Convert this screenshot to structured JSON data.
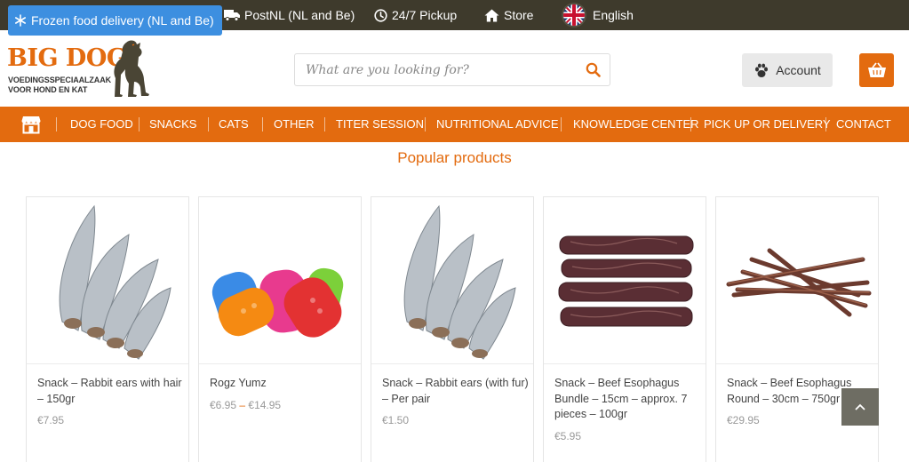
{
  "topbar": {
    "items": [
      {
        "label": "Frozen food delivery (NL and Be)",
        "icon": "snowflake-icon"
      },
      {
        "label": "PostNL (NL and Be)",
        "icon": "truck-icon"
      },
      {
        "label": "24/7 Pickup",
        "icon": "clock-icon"
      },
      {
        "label": "Store",
        "icon": "home-icon"
      }
    ],
    "language": "English",
    "language_icon": "uk-flag-icon"
  },
  "header": {
    "logo_title": "BIG DOG",
    "logo_line1": "VOEDINGSSPECIAALZAAK",
    "logo_line2": "VOOR HOND EN KAT",
    "search_placeholder": "What are you looking for?",
    "account_label": "Account"
  },
  "nav": {
    "items": [
      "DOG FOOD",
      "SNACKS",
      "CATS",
      "OTHER",
      "TITER SESSION",
      "NUTRITIONAL ADVICE",
      "KNOWLEDGE CENTER",
      "PICK UP OR DELIVERY",
      "CONTACT"
    ]
  },
  "section_title": "Popular products",
  "products": [
    {
      "name": "Snack – Rabbit ears with hair – 150gr",
      "price": "€7.95"
    },
    {
      "name": "Rogz Yumz",
      "price_from": "€6.95",
      "price_sep": "–",
      "price_to": "€14.95"
    },
    {
      "name": "Snack – Rabbit ears (with fur) – Per pair",
      "price": "€1.50"
    },
    {
      "name": "Snack – Beef Esophagus Bundle – 15cm – approx. 7 pieces – 100gr",
      "price": "€5.95"
    },
    {
      "name": "Snack – Beef Esophagus Round – 30cm – 750gr",
      "price": "€29.95"
    }
  ],
  "colors": {
    "accent": "#e36b0f",
    "topbar": "#3e3a2c",
    "pill": "#3d8fe0"
  }
}
